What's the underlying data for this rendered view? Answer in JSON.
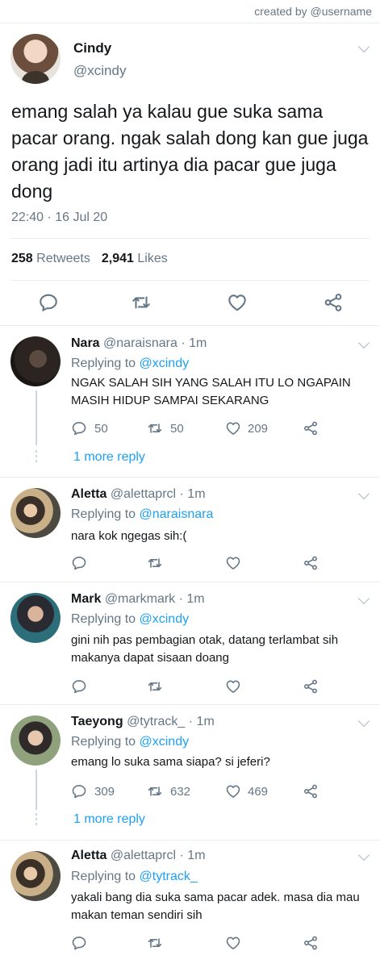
{
  "credit": "created by @username",
  "main_tweet": {
    "name": "Cindy",
    "handle": "@xcindy",
    "text": "emang salah ya kalau gue suka sama pacar orang. ngak salah dong kan gue juga orang jadi itu artinya dia pacar gue juga dong",
    "time": "22:40 · 16 Jul 20",
    "retweets_count": "258",
    "retweets_label": "Retweets",
    "likes_count": "2,941",
    "likes_label": "Likes"
  },
  "replies": [
    {
      "name": "Nara",
      "meta": "@naraisnara · 1m",
      "replying_label": "Replying to",
      "replying_to": "@xcindy",
      "text": "NGAK SALAH SIH YANG SALAH ITU LO NGAPAIN MASIH HIDUP SAMPAI SEKARANG",
      "reply_count": "50",
      "retweet_count": "50",
      "like_count": "209",
      "more_replies": "1 more reply"
    },
    {
      "name": "Aletta",
      "meta": "@alettaprcl · 1m",
      "replying_label": "Replying to",
      "replying_to": "@naraisnara",
      "text": "nara kok ngegas sih:("
    },
    {
      "name": "Mark",
      "meta": "@markmark · 1m",
      "replying_label": "Replying to",
      "replying_to": "@xcindy",
      "text": "gini nih pas pembagian otak, datang terlambat sih makanya dapat sisaan doang"
    },
    {
      "name": "Taeyong",
      "meta": "@tytrack_ · 1m",
      "replying_label": "Replying to",
      "replying_to": "@xcindy",
      "text": "emang lo suka sama siapa? si jeferi?",
      "reply_count": "309",
      "retweet_count": "632",
      "like_count": "469",
      "more_replies": "1 more reply"
    },
    {
      "name": "Aletta",
      "meta": "@alettaprcl · 1m",
      "replying_label": "Replying to",
      "replying_to": "@tytrack_",
      "text": "yakali bang dia suka sama pacar adek. masa dia mau makan teman sendiri sih"
    }
  ],
  "colors": {
    "link": "#1da1f2",
    "secondary_text": "#657786",
    "icon": "#657786",
    "divider": "#e6ecf0"
  },
  "icons": [
    "reply-icon",
    "retweet-icon",
    "like-icon",
    "share-icon",
    "chevron-down-icon"
  ]
}
